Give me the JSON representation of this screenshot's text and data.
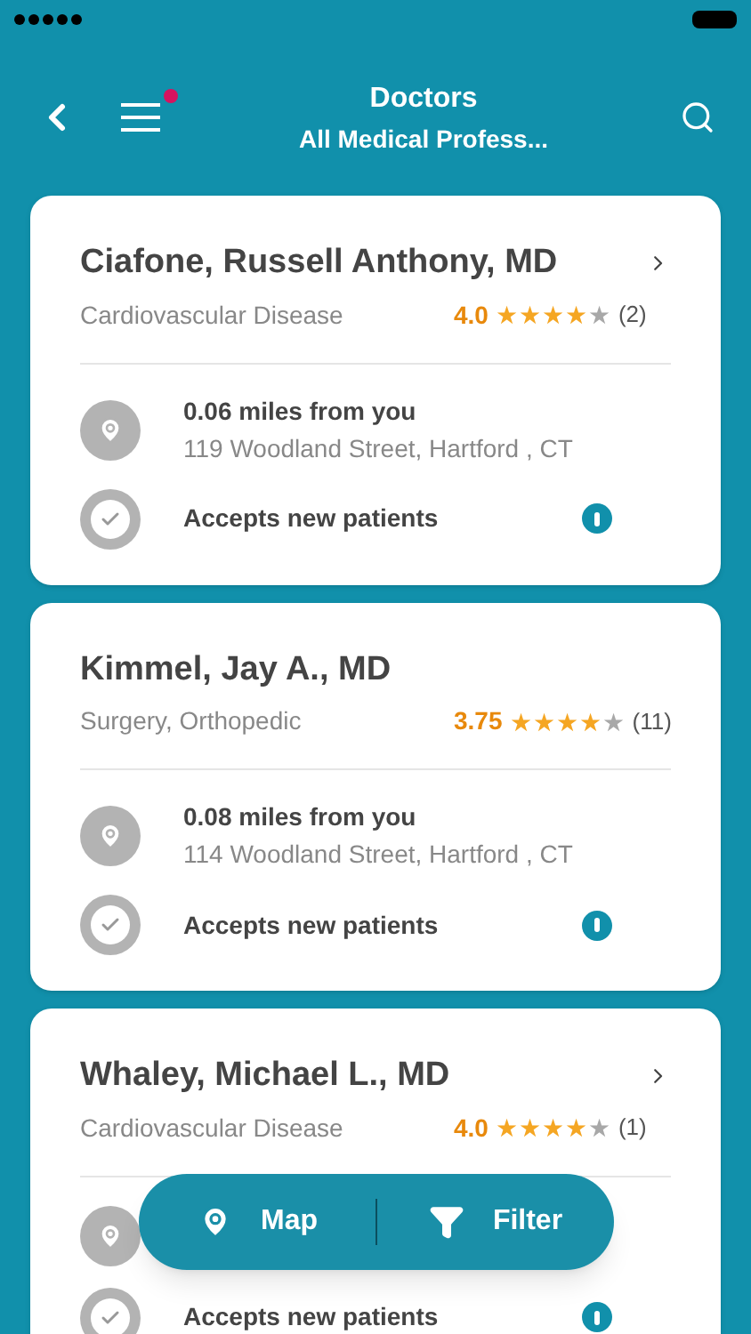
{
  "header": {
    "title": "Doctors",
    "subtitle": "All Medical Profess...",
    "menu_badge": true
  },
  "doctors": [
    {
      "name": "Ciafone, Russell Anthony, MD",
      "specialty": "Cardiovascular Disease",
      "rating": "4.0",
      "stars": 4,
      "reviews": "(2)",
      "distance": "0.06 miles from you",
      "address": "119 Woodland Street, Hartford , CT",
      "accepts": "Accepts new patients"
    },
    {
      "name": "Kimmel, Jay A., MD",
      "specialty": "Surgery, Orthopedic",
      "rating": "3.75",
      "stars": 4,
      "reviews": "(11)",
      "distance": "0.08 miles from you",
      "address": "114 Woodland Street, Hartford , CT",
      "accepts": "Accepts new patients"
    },
    {
      "name": "Whaley, Michael L., MD",
      "specialty": "Cardiovascular Disease",
      "rating": "4.0",
      "stars": 4,
      "reviews": "(1)",
      "accepts": "Accepts new patients"
    }
  ],
  "bottom_bar": {
    "map": "Map",
    "filter": "Filter"
  }
}
